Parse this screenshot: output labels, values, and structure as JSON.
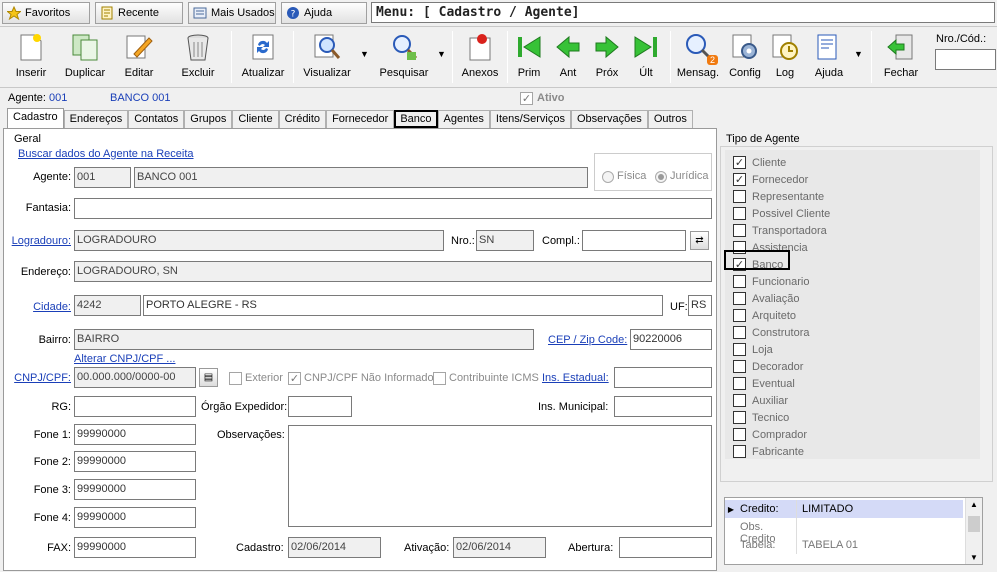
{
  "top": {
    "favoritos": "Favoritos",
    "recente": "Recente",
    "mais_usados": "Mais Usados",
    "ajuda": "Ajuda",
    "menu_title": "Menu: [ Cadastro / Agente]"
  },
  "toolbar": {
    "inserir": "Inserir",
    "duplicar": "Duplicar",
    "editar": "Editar",
    "excluir": "Excluir",
    "atualizar": "Atualizar",
    "visualizar": "Visualizar",
    "pesquisar": "Pesquisar",
    "anexos": "Anexos",
    "prim": "Prim",
    "ant": "Ant",
    "prox": "Próx",
    "ult": "Últ",
    "mensag": "Mensag.",
    "mensag_badge": "2",
    "config": "Config",
    "log": "Log",
    "ajuda": "Ajuda",
    "fechar": "Fechar",
    "nro_label": "Nro./Cód.:"
  },
  "header": {
    "agente_label": "Agente:",
    "agente_code": "001",
    "agente_name": "BANCO 001",
    "ativo_label": "Ativo"
  },
  "tabs": [
    "Cadastro",
    "Endereços",
    "Contatos",
    "Grupos",
    "Cliente",
    "Crédito",
    "Fornecedor",
    "Banco",
    "Agentes",
    "Itens/Serviços",
    "Observações",
    "Outros"
  ],
  "form": {
    "geral": "Geral",
    "buscar": "Buscar dados do Agente na Receita",
    "agente_label": "Agente:",
    "agente_code": "001",
    "agente_name": "BANCO 001",
    "fisica": "Física",
    "juridica": "Jurídica",
    "fantasia_label": "Fantasia:",
    "fantasia": "",
    "logradouro_label": "Logradouro:",
    "logradouro": "LOGRADOURO",
    "nro_label": "Nro.:",
    "nro": "SN",
    "compl_label": "Compl.:",
    "compl": "",
    "endereco_label": "Endereço:",
    "endereco": "LOGRADOURO, SN",
    "cidade_label": "Cidade:",
    "cidade_code": "4242",
    "cidade_name": "PORTO ALEGRE - RS",
    "uf_label": "UF:",
    "uf": "RS",
    "bairro_label": "Bairro:",
    "bairro": "BAIRRO",
    "cep_label": "CEP / Zip Code:",
    "cep": "90220006",
    "alterar_cnpj": "Alterar CNPJ/CPF ...",
    "cnpj_label": "CNPJ/CPF:",
    "cnpj": "00.000.000/0000-00",
    "exterior": "Exterior",
    "cnpj_nao_informado": "CNPJ/CPF Não Informado",
    "contribuinte_icms": "Contribuinte ICMS",
    "ins_estadual_label": "Ins. Estadual:",
    "ins_estadual": "",
    "rg_label": "RG:",
    "rg": "",
    "orgao_label": "Órgão Expedidor:",
    "orgao": "",
    "ins_municipal_label": "Ins. Municipal:",
    "ins_municipal": "",
    "fone1_label": "Fone 1:",
    "fone1": "99990000",
    "fone2_label": "Fone 2:",
    "fone2": "99990000",
    "fone3_label": "Fone 3:",
    "fone3": "99990000",
    "fone4_label": "Fone 4:",
    "fone4": "99990000",
    "obs_label": "Observações:",
    "fax_label": "FAX:",
    "fax": "99990000",
    "cadastro_label": "Cadastro:",
    "cadastro": "02/06/2014",
    "ativacao_label": "Ativação:",
    "ativacao": "02/06/2014",
    "abertura_label": "Abertura:",
    "abertura": ""
  },
  "tipo_agente": {
    "title": "Tipo de Agente",
    "items": [
      {
        "label": "Cliente",
        "checked": true
      },
      {
        "label": "Fornecedor",
        "checked": true
      },
      {
        "label": "Representante",
        "checked": false
      },
      {
        "label": "Possivel Cliente",
        "checked": false
      },
      {
        "label": "Transportadora",
        "checked": false
      },
      {
        "label": "Assistencia",
        "checked": false
      },
      {
        "label": "Banco",
        "checked": true
      },
      {
        "label": "Funcionario",
        "checked": false
      },
      {
        "label": "Avaliação",
        "checked": false
      },
      {
        "label": "Arquiteto",
        "checked": false
      },
      {
        "label": "Construtora",
        "checked": false
      },
      {
        "label": "Loja",
        "checked": false
      },
      {
        "label": "Decorador",
        "checked": false
      },
      {
        "label": "Eventual",
        "checked": false
      },
      {
        "label": "Auxiliar",
        "checked": false
      },
      {
        "label": "Tecnico",
        "checked": false
      },
      {
        "label": "Comprador",
        "checked": false
      },
      {
        "label": "Fabricante",
        "checked": false
      }
    ]
  },
  "credit_grid": [
    {
      "key": "Credito:",
      "value": "LIMITADO"
    },
    {
      "key": "Obs. Credito",
      "value": ""
    },
    {
      "key": "Tabela:",
      "value": "TABELA 01"
    }
  ]
}
